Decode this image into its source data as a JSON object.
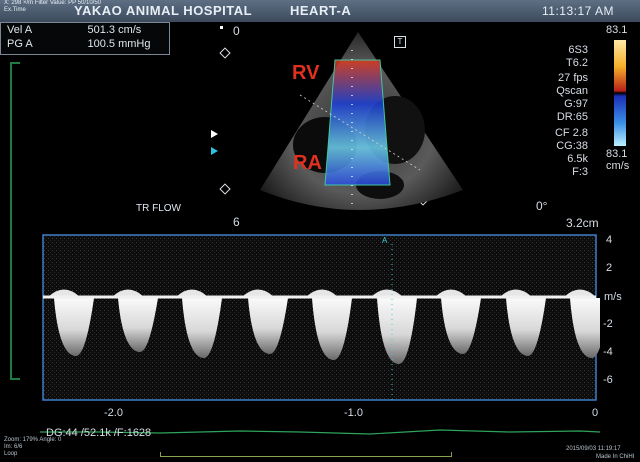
{
  "header": {
    "small_lines": [
      "X: 298 ×/m  Filter Value: PP 50/10/50",
      "Ex.Time"
    ],
    "hospital": "YAKAO ANIMAL HOSPITAL",
    "mode": "HEART-A",
    "time": "11:13:17 AM"
  },
  "measurements": [
    {
      "label": "Vel  A",
      "value": "501.3",
      "unit": "cm/s"
    },
    {
      "label": "PG  A",
      "value": "100.5",
      "unit": "mmHg"
    }
  ],
  "depth_top": "0",
  "depth_bottom": "6",
  "probe": "6S3",
  "params": [
    "T6.2",
    "27 fps",
    "Qscan",
    "G:97",
    "DR:65",
    "CF 2.8",
    "CG:38",
    "6.5k",
    "F:3"
  ],
  "color_scale": {
    "max": "83.1",
    "min": "83.1",
    "unit": "cm/s"
  },
  "labels": {
    "rv": "RV",
    "ra": "RA",
    "flow": "TR FLOW",
    "gate": "A"
  },
  "angle": "0°",
  "sample_depth": "3.2cm",
  "doppler": {
    "y_ticks": [
      "4",
      "2",
      "-2",
      "-4",
      "-6"
    ],
    "unit": "m/s",
    "x_ticks": [
      "-2.0",
      "-1.0",
      "0"
    ],
    "status": "DG:44  /52.1k  /F:1628"
  },
  "footer": {
    "left_lines": [
      "Zoom: 179%  Angle: 0",
      "Im: 6/6",
      "Loop"
    ],
    "date": "2015/09/03 11:19:17",
    "made_in": "Made In ChiHI"
  },
  "colors": {
    "doppler_border": "#3f7fc8",
    "label_red": "#e0311f",
    "ecg": "#2ea35a"
  }
}
